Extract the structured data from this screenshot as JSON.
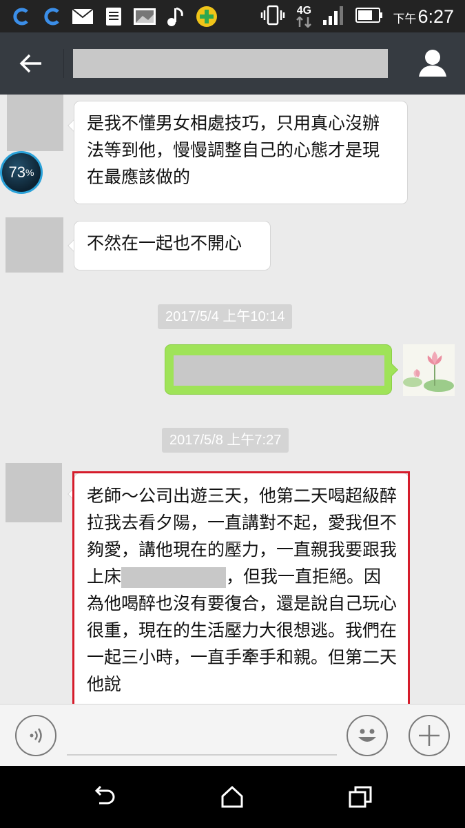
{
  "status_bar": {
    "time_prefix": "下午",
    "time": "6:27",
    "network": "4G",
    "icons_left": [
      "sync-icon",
      "sync-icon",
      "mail-icon",
      "document-icon",
      "image-icon",
      "music-icon",
      "add-app-icon"
    ],
    "icons_right": [
      "vibrate-icon",
      "4g-icon",
      "signal-icon",
      "battery-icon"
    ]
  },
  "header": {
    "title": "",
    "back_icon": "arrow-left-icon",
    "profile_icon": "person-icon"
  },
  "messages": [
    {
      "side": "left",
      "text": "是我不懂男女相處技巧，只用真心沒辦法等到他，慢慢調整自己的心態才是現在最應該做的"
    },
    {
      "side": "left",
      "text": "不然在一起也不開心"
    },
    {
      "type": "timestamp",
      "text": "2017/5/4 上午10:14"
    },
    {
      "side": "right",
      "text": ""
    },
    {
      "type": "timestamp",
      "text": "2017/5/8 上午7:27"
    },
    {
      "side": "left",
      "text_before": "老師～公司出遊三天，他第二天喝超級醉拉我去看夕陽，一直講對不起，愛我但不夠愛，講他現在的壓力，一直親我要跟我上床",
      "text_after": "，但我一直拒絕。因為他喝醉也沒有要復合，還是說自己玩心很重，現在的生活壓力大很想逃。我們在一起三小時，一直手牽手和親。但第二天他說"
    }
  ],
  "overlay_badge": {
    "value": "73",
    "unit": "%"
  },
  "input_bar": {
    "voice_icon": "voice-icon",
    "emoji_icon": "smiley-icon",
    "plus_icon": "plus-icon",
    "value": ""
  },
  "nav_bar": {
    "back": "back-icon",
    "home": "home-icon",
    "recents": "recents-icon"
  },
  "colors": {
    "highlight": "#d51c2b",
    "sent_bubble": "#9fe358",
    "title_bar": "#363b41"
  }
}
